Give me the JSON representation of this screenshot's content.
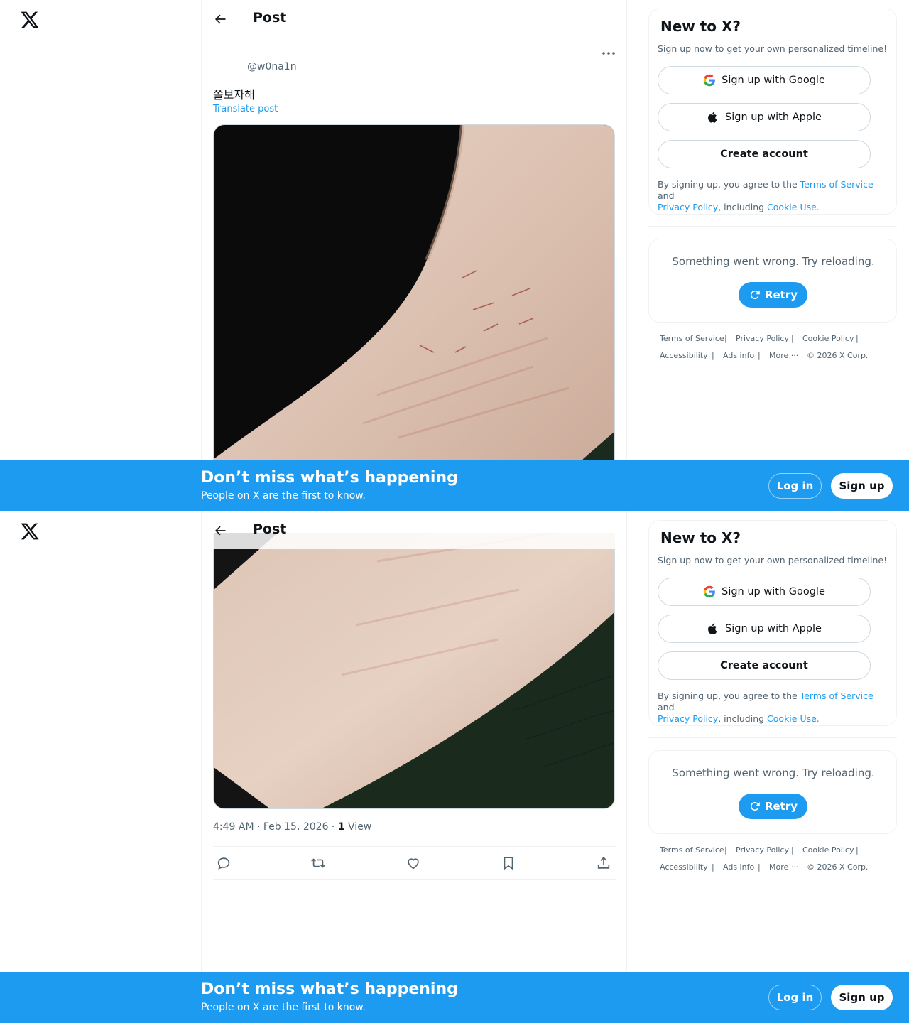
{
  "header": {
    "title": "Post"
  },
  "post": {
    "handle": "@w0na1n",
    "text": "쫄보자해",
    "translate_label": "Translate post",
    "time": "4:49 AM · Feb 15, 2026 · ",
    "views_count": "1",
    "views_label": " View",
    "image_alt": "Photo of a forearm with several small red scratches"
  },
  "signup": {
    "title": "New to X?",
    "subtitle": "Sign up now to get your own personalized timeline!",
    "google_label": "Sign up with Google",
    "apple_label": "Sign up with Apple",
    "create_label": "Create account",
    "legal_prefix": "By signing up, you agree to the ",
    "terms_link": "Terms of Service",
    "legal_and": " and",
    "privacy_link": "Privacy Policy",
    "legal_including": ", including ",
    "cookie_link": "Cookie Use."
  },
  "error": {
    "message": "Something went wrong. Try reloading.",
    "retry_label": "Retry"
  },
  "footer": {
    "terms": "Terms of Service",
    "privacy": "Privacy Policy",
    "cookie": "Cookie Policy",
    "accessibility": "Accessibility",
    "ads": "Ads info",
    "more": "More ···",
    "copyright": "© 2026 X Corp.",
    "separator": "|"
  },
  "banner": {
    "title": "Don’t miss what’s happening",
    "subtitle": "People on X are the first to know.",
    "login_label": "Log in",
    "signup_label": "Sign up"
  },
  "icons": {
    "logo": "x-logo-icon",
    "back": "arrow-left-icon",
    "more": "more-horizontal-icon",
    "google": "google-icon",
    "apple": "apple-icon",
    "retry": "refresh-icon",
    "reply": "reply-icon",
    "repost": "repost-icon",
    "like": "heart-icon",
    "bookmark": "bookmark-icon",
    "share": "share-icon"
  },
  "colors": {
    "accent": "#1d9bf0",
    "text": "#0f1419",
    "secondary": "#536471",
    "border": "#eff3f4"
  }
}
